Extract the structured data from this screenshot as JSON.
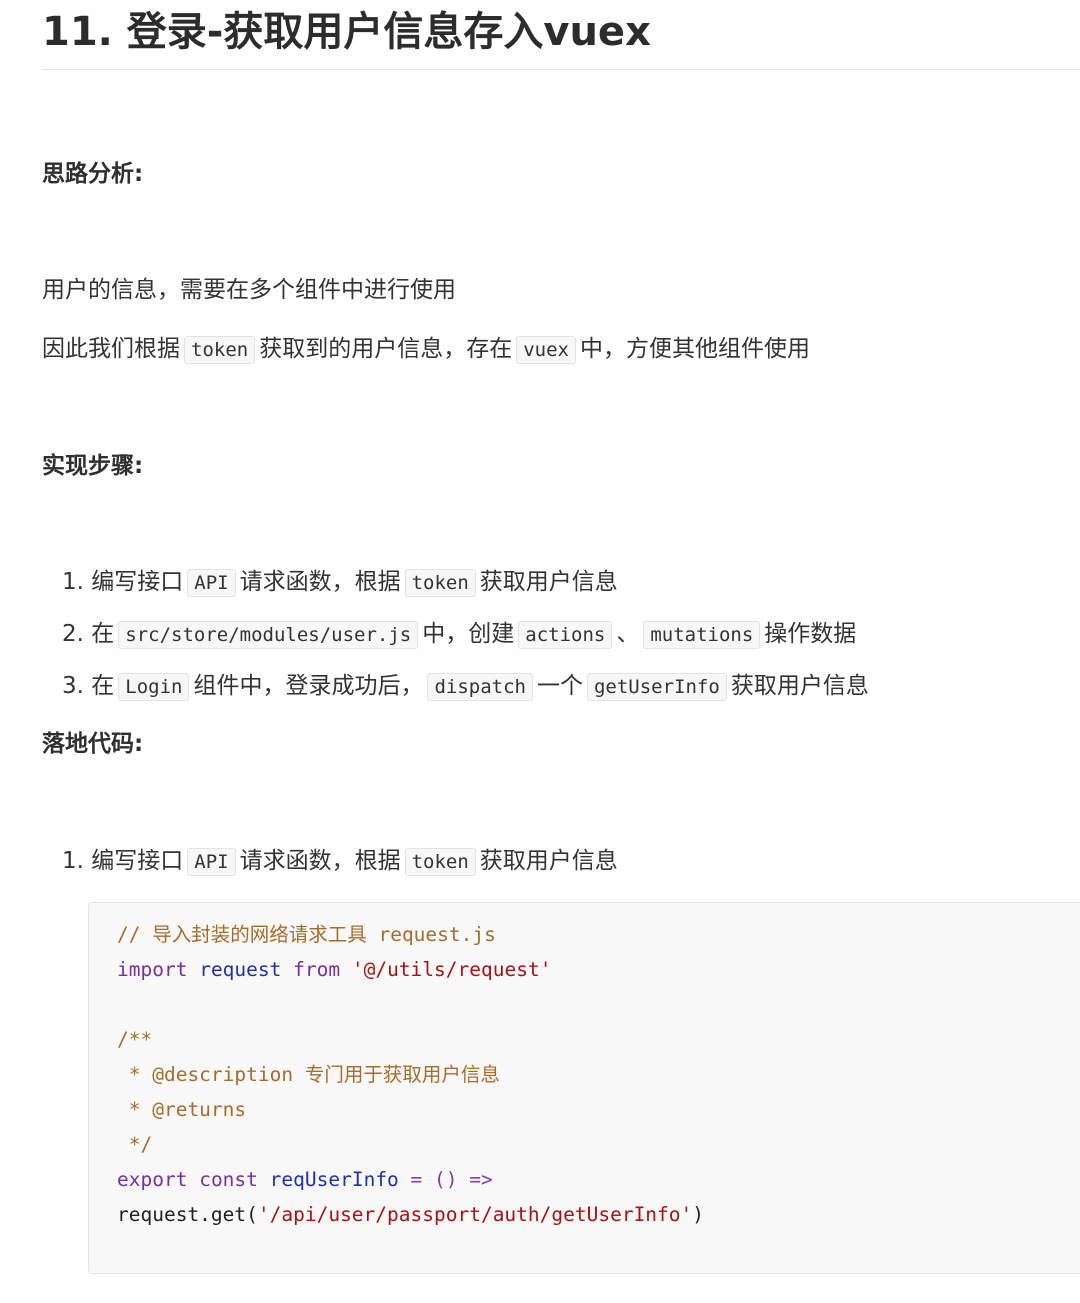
{
  "title": "11. 登录-获取用户信息存入vuex",
  "sections": {
    "analysis_heading": "思路分析:",
    "analysis_line1": "用户的信息，需要在多个组件中进行使用",
    "analysis_line2": {
      "p1": "因此我们根据",
      "c1": "token",
      "p2": "获取到的用户信息，存在",
      "c2": "vuex",
      "p3": "中，方便其他组件使用"
    },
    "steps_heading": "实现步骤:",
    "steps": [
      {
        "num": "1.",
        "p1": "编写接口",
        "c1": "API",
        "p2": "请求函数，根据",
        "c2": "token",
        "p3": "获取用户信息"
      },
      {
        "num": "2.",
        "p1": "在",
        "c1": "src/store/modules/user.js",
        "p2": "中，创建",
        "c2": "actions",
        "p3": "、",
        "c3": "mutations",
        "p4": "操作数据"
      },
      {
        "num": "3.",
        "p1": "在",
        "c1": "Login",
        "p2": "组件中，登录成功后，",
        "c2": "dispatch",
        "p3": "一个",
        "c3": "getUserInfo",
        "p4": "获取用户信息"
      }
    ],
    "code_heading": "落地代码:",
    "code_steps": [
      {
        "num": "1.",
        "p1": "编写接口",
        "c1": "API",
        "p2": "请求函数，根据",
        "c2": "token",
        "p3": "获取用户信息"
      }
    ]
  },
  "code": {
    "line1_comment": "// 导入封装的网络请求工具 request.js",
    "line2_import": "import",
    "line2_name": "request",
    "line2_from": "from",
    "line2_path": "'@/utils/request'",
    "doc_open": "/**",
    "doc_desc": " * @description 专门用于获取用户信息",
    "doc_returns": " * @returns",
    "doc_close": " */",
    "export_kw": "export",
    "const_kw": "const",
    "fn_name": "reqUserInfo",
    "arrow": " = () =>",
    "call_prefix": "request.get(",
    "call_url": "'/api/user/passport/auth/getUserInfo'",
    "call_suffix": ")"
  }
}
